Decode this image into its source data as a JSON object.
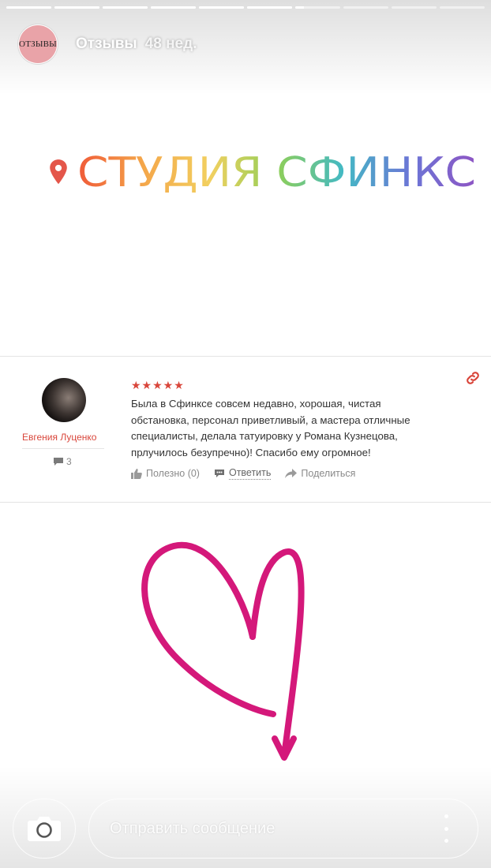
{
  "story": {
    "progress": {
      "segments": 10,
      "completed": 6,
      "current_fraction": 0.2
    },
    "author": {
      "avatar_text": "ОТЗЫВЫ",
      "name": "Отзывы",
      "time": "48 нед."
    }
  },
  "studio": {
    "title_parts": [
      {
        "text": "СТУДИЯ",
        "color": "#f4743a"
      },
      {
        "text": " ",
        "color": "#f4743a"
      },
      {
        "text": "СФИНКС",
        "color": "#7fc242"
      }
    ],
    "title": "СТУДИЯ СФИНКС",
    "pin_color": "#e4564a",
    "gradient": [
      "#f05a38",
      "#f4a74a",
      "#f2d060",
      "#8fcf58",
      "#43b9c4",
      "#6b76d6",
      "#8e55c4"
    ]
  },
  "review": {
    "author_name": "Евгения Луценко",
    "review_count": "3",
    "stars": "★★★★★",
    "text": "Была в Сфинксе совсем недавно, хорошая, чистая обстановка, персонал приветливый, а мастера отличные специалисты, делала татуировку у Романа Кузнецова, прлучилось безупречно)! Спасибо ему огромное!",
    "helpful": "Полезно (0)",
    "reply": "Ответить",
    "share": "Поделиться",
    "accent_color": "#d9463b"
  },
  "sticker": {
    "icon": "heart-doodle-icon",
    "color": "#d4187a"
  },
  "footer": {
    "message_placeholder": "Отправить сообщение"
  }
}
